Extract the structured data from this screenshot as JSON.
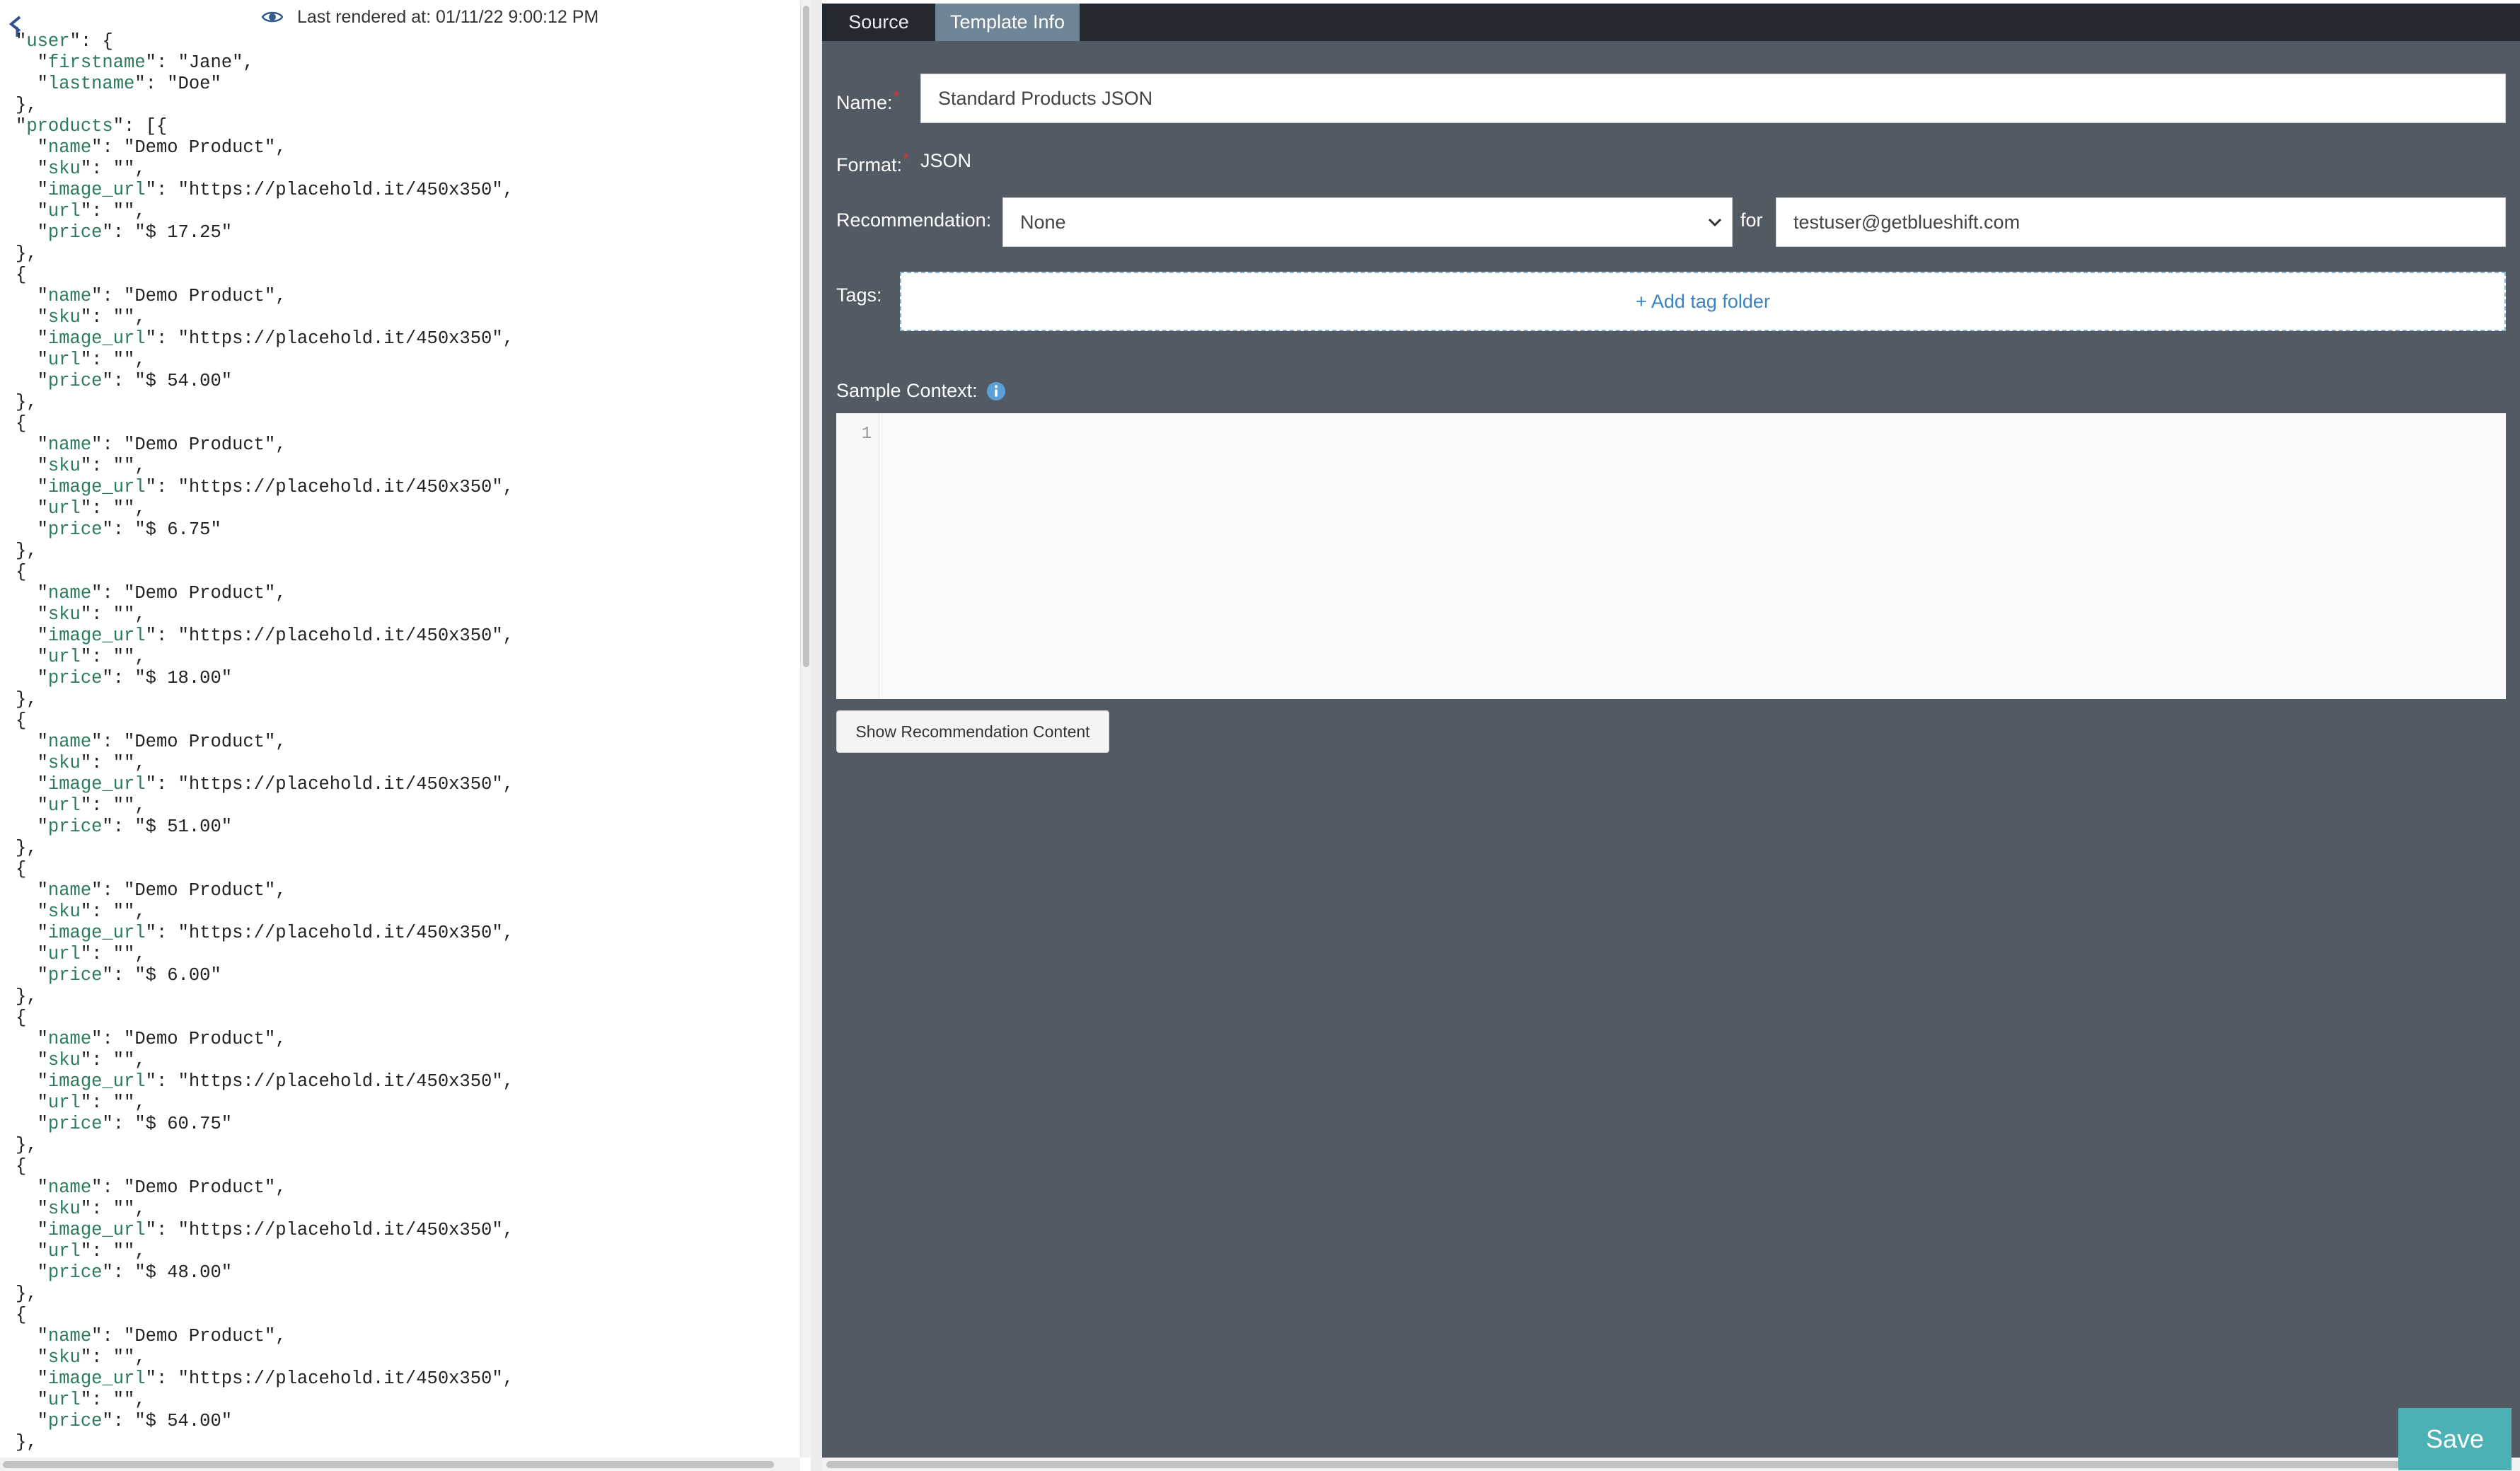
{
  "preview": {
    "last_rendered": "Last rendered at: 01/11/22 9:00:12 PM",
    "user": {
      "firstname": "Jane",
      "lastname": "Doe"
    },
    "products": [
      {
        "name": "Demo Product",
        "sku": "",
        "image_url": "https://placehold.it/450x350",
        "url": "",
        "price": "$ 17.25"
      },
      {
        "name": "Demo Product",
        "sku": "",
        "image_url": "https://placehold.it/450x350",
        "url": "",
        "price": "$ 54.00"
      },
      {
        "name": "Demo Product",
        "sku": "",
        "image_url": "https://placehold.it/450x350",
        "url": "",
        "price": "$ 6.75"
      },
      {
        "name": "Demo Product",
        "sku": "",
        "image_url": "https://placehold.it/450x350",
        "url": "",
        "price": "$ 18.00"
      },
      {
        "name": "Demo Product",
        "sku": "",
        "image_url": "https://placehold.it/450x350",
        "url": "",
        "price": "$ 51.00"
      },
      {
        "name": "Demo Product",
        "sku": "",
        "image_url": "https://placehold.it/450x350",
        "url": "",
        "price": "$ 6.00"
      },
      {
        "name": "Demo Product",
        "sku": "",
        "image_url": "https://placehold.it/450x350",
        "url": "",
        "price": "$ 60.75"
      },
      {
        "name": "Demo Product",
        "sku": "",
        "image_url": "https://placehold.it/450x350",
        "url": "",
        "price": "$ 48.00"
      },
      {
        "name": "Demo Product",
        "sku": "",
        "image_url": "https://placehold.it/450x350",
        "url": "",
        "price": "$ 54.00"
      }
    ]
  },
  "tabs": [
    {
      "label": "Source",
      "active": false
    },
    {
      "label": "Template Info",
      "active": true
    }
  ],
  "form": {
    "name_label": "Name:",
    "name_value": "Standard Products JSON",
    "format_label": "Format:",
    "format_value": "JSON",
    "recommendation_label": "Recommendation:",
    "recommendation_value": "None",
    "for_label": "for",
    "for_value": "testuser@getblueshift.com",
    "tags_label": "Tags:",
    "add_tag_folder": "+ Add tag folder",
    "sample_context_label": "Sample Context:",
    "editor_line_number": "1",
    "show_recommendation_button": "Show Recommendation Content",
    "save_button": "Save",
    "required_marker": "*"
  },
  "colors": {
    "panel_bg": "#525a64",
    "tabbar_bg": "#24292f",
    "active_tab": "#6f8597",
    "save_button": "#4cb1b5",
    "link_blue": "#3a83c4",
    "json_key": "#2b7a5a",
    "required": "#dd3333"
  },
  "icons": {
    "eye": "eye-icon",
    "back": "chevron-left-icon",
    "info": "info-circle-icon",
    "dropdown": "chevron-down-icon"
  }
}
